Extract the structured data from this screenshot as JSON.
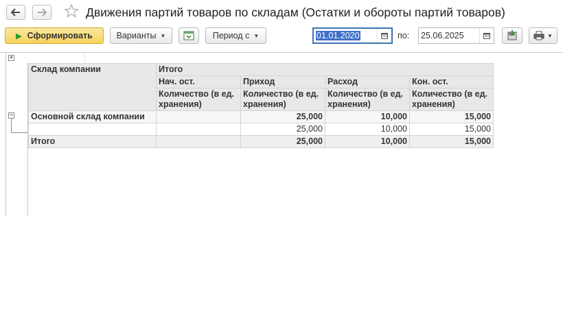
{
  "window": {
    "title": "Движения партий товаров по складам (Остатки и обороты партий товаров)"
  },
  "toolbar": {
    "generate_label": "Сформировать",
    "variants_label": "Варианты",
    "period_label": "Период с",
    "to_label": "по:",
    "date_from": "01.01.2020",
    "date_to": "25.06.2025"
  },
  "report": {
    "header": {
      "row_dimension": "Склад компании",
      "group_total": "Итого",
      "columns": [
        "Нач. ост.",
        "Приход",
        "Расход",
        "Кон. ост."
      ],
      "unit": "Количество (в ед. хранения)"
    },
    "rows": [
      {
        "name": "Основной склад компании",
        "values": [
          "",
          "25,000",
          "10,000",
          "15,000"
        ]
      },
      {
        "name": "",
        "values": [
          "",
          "25,000",
          "10,000",
          "15,000"
        ]
      }
    ],
    "total": {
      "name": "Итого",
      "values": [
        "",
        "25,000",
        "10,000",
        "15,000"
      ]
    }
  },
  "colors": {
    "accent": "#f6d35b",
    "active_border": "#3b73b3",
    "selection": "#3e70c8",
    "header_bg": "#e8e8e8"
  }
}
